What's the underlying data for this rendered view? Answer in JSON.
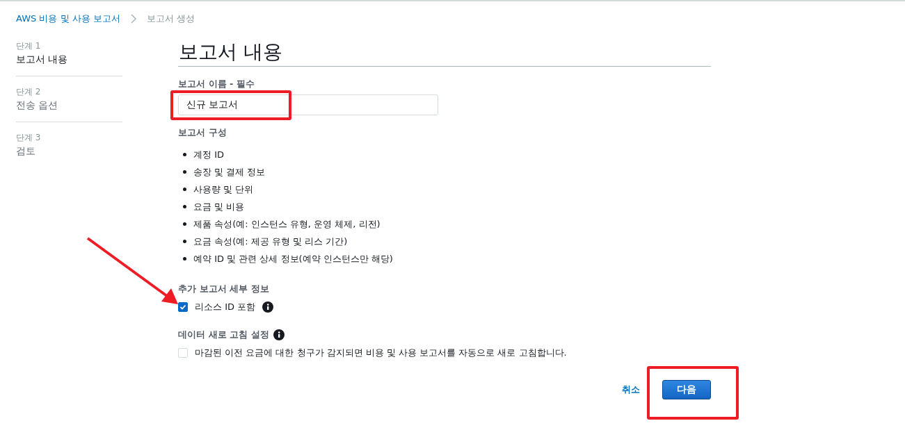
{
  "breadcrumb": {
    "link": "AWS 비용 및 사용 보고서",
    "current": "보고서 생성"
  },
  "steps": [
    {
      "step": "단계 1",
      "title": "보고서 내용",
      "selected": true
    },
    {
      "step": "단계 2",
      "title": "전송 옵션",
      "selected": false
    },
    {
      "step": "단계 3",
      "title": "검토",
      "selected": false
    }
  ],
  "heading": "보고서 내용",
  "report_name": {
    "label": "보고서 이름 - 필수",
    "value": "신규 보고서"
  },
  "composition": {
    "label": "보고서 구성",
    "items": [
      "계정 ID",
      "송장 및 결제 정보",
      "사용량 및 단위",
      "요금 및 비용",
      "제품 속성(예: 인스턴스 유형, 운영 체제, 리전)",
      "요금 속성(예: 제공 유형 및 리스 기간)",
      "예약 ID 및 관련 상세 정보(예약 인스턴스만 해당)"
    ]
  },
  "details": {
    "label": "추가 보고서 세부 정보",
    "option": {
      "label": "리소스 ID 포함",
      "checked": true
    }
  },
  "refresh": {
    "label": "데이터 새로 고침 설정",
    "option": {
      "label": "마감된 이전 요금에 대한 청구가 감지되면 비용 및 사용 보고서를 자동으로 새로 고침합니다.",
      "checked": false
    }
  },
  "buttons": {
    "cancel": "취소",
    "next": "다음"
  },
  "annotations": [
    {
      "kind": "box"
    },
    {
      "kind": "arrow"
    },
    {
      "kind": "box"
    }
  ]
}
